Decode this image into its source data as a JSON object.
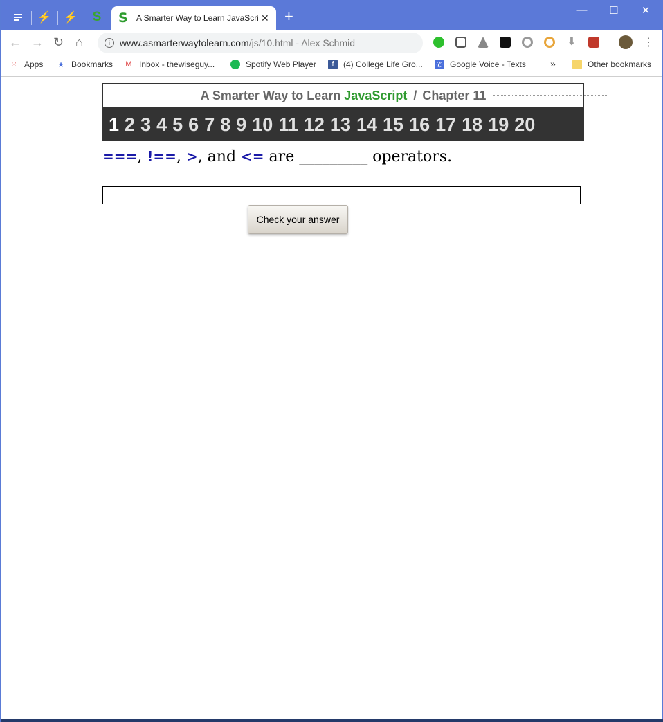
{
  "browser": {
    "active_tab": {
      "title": "A Smarter Way to Learn JavaScrip",
      "favicon": "S"
    },
    "pinned_tabs": [
      "menu-icon",
      "deviantart-icon",
      "deviantart-icon",
      "s-icon"
    ],
    "url": {
      "host": "www.asmarterwaytolearn.com",
      "path": "/js/10.html - Alex Schmid"
    },
    "bookmarks": [
      {
        "label": "Apps",
        "icon": "apps-grid-icon"
      },
      {
        "label": "Bookmarks",
        "icon": "star-icon"
      },
      {
        "label": "Inbox - thewiseguy...",
        "icon": "gmail-icon"
      },
      {
        "label": "Spotify Web Player",
        "icon": "spotify-icon"
      },
      {
        "label": "(4) College Life Gro...",
        "icon": "facebook-icon"
      },
      {
        "label": "Google Voice - Texts",
        "icon": "phone-icon"
      }
    ],
    "overflow": "»",
    "other_bookmarks": "Other bookmarks"
  },
  "page": {
    "header": {
      "prefix": "A Smarter Way to Learn",
      "highlight": "JavaScript",
      "separator": "/",
      "chapter": "Chapter 11"
    },
    "chapters": [
      "1",
      "2",
      "3",
      "4",
      "5",
      "6",
      "7",
      "8",
      "9",
      "10",
      "11",
      "12",
      "13",
      "14",
      "15",
      "16",
      "17",
      "18",
      "19",
      "20"
    ],
    "current_chapter": "1",
    "question": {
      "op1": "===",
      "sep1": ", ",
      "op2": "!==",
      "sep2": ", ",
      "op3": ">",
      "sep3": ", and ",
      "op4": "<=",
      "rest": " are _________ operators."
    },
    "answer_value": "",
    "check_button": "Check your answer"
  },
  "colors": {
    "titlebar": "#5b79d8",
    "accent_green": "#2f9a2f",
    "chapter_bar": "#333333",
    "operator_blue": "#1a1aa8"
  }
}
